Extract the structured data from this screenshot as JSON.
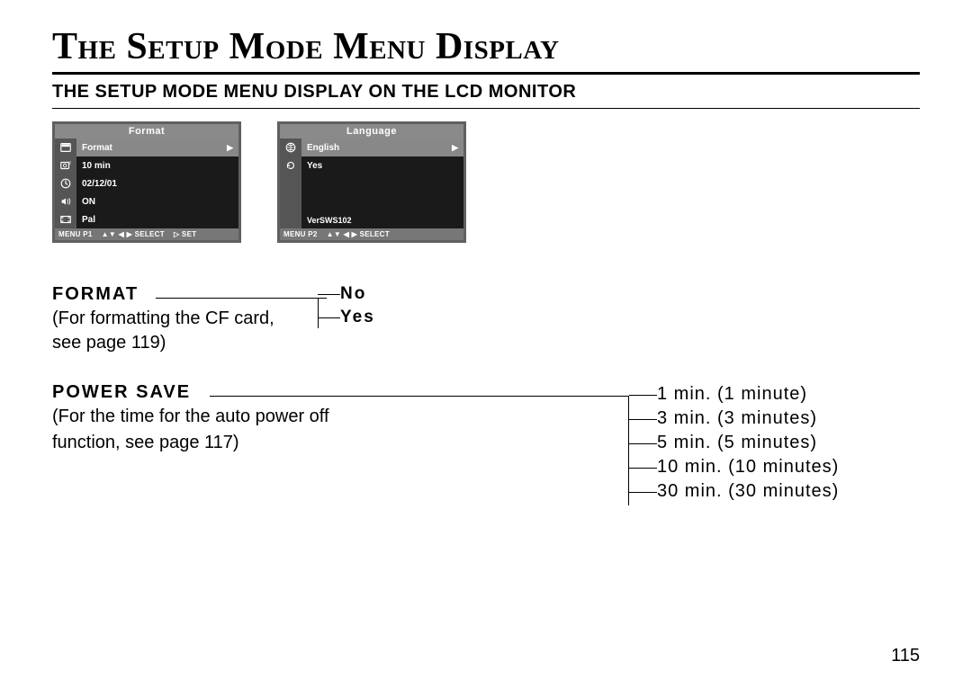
{
  "title": "The Setup Mode Menu Display",
  "subtitle": "THE SETUP MODE MENU DISPLAY ON THE LCD MONITOR",
  "lcd1": {
    "header": "Format",
    "items": [
      "Format",
      "10 min",
      "02/12/01",
      "ON",
      "Pal"
    ],
    "footer": [
      "MENU P1",
      "▲▼ ◀ ▶ SELECT",
      "▷ SET"
    ]
  },
  "lcd2": {
    "header": "Language",
    "items": [
      "English",
      "Yes"
    ],
    "version": "VerSWS102",
    "footer": [
      "MENU P2",
      "▲▼ ◀ ▶ SELECT"
    ]
  },
  "format": {
    "heading": "FORMAT",
    "desc": "(For formatting the CF card, see page 119)",
    "options": [
      "No",
      "Yes"
    ]
  },
  "powersave": {
    "heading": "POWER SAVE",
    "desc1": "(For the time for the auto power off",
    "desc2": "function, see page 117)",
    "options": [
      "1 min. (1 minute)",
      "3 min. (3 minutes)",
      "5 min. (5 minutes)",
      "10 min. (10 minutes)",
      "30 min. (30 minutes)"
    ]
  },
  "page_number": "115"
}
